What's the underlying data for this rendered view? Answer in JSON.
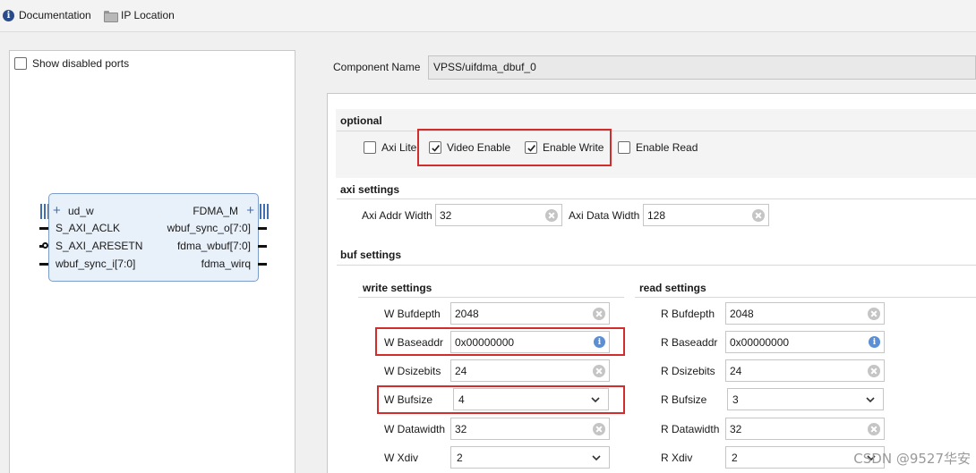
{
  "toolbar": {
    "documentation_label": "Documentation",
    "ip_location_label": "IP Location",
    "documentation_icon": "info-icon",
    "ip_location_icon": "folder-icon"
  },
  "left_panel": {
    "show_disabled_ports_label": "Show disabled ports",
    "show_disabled_ports_checked": false
  },
  "ip_block": {
    "left_ports": [
      "ud_w",
      "S_AXI_ACLK",
      "S_AXI_ARESETN",
      "wbuf_sync_i[7:0]"
    ],
    "right_ports": [
      "FDMA_M",
      "wbuf_sync_o[7:0]",
      "fdma_wbuf[7:0]",
      "fdma_wirq"
    ]
  },
  "component": {
    "label": "Component Name",
    "value": "VPSS/uifdma_dbuf_0"
  },
  "optional": {
    "title": "optional",
    "axi_lite": {
      "label": "Axi Lite",
      "checked": false
    },
    "video_enable": {
      "label": "Video Enable",
      "checked": true
    },
    "enable_write": {
      "label": "Enable Write",
      "checked": true
    },
    "enable_read": {
      "label": "Enable Read",
      "checked": false
    }
  },
  "axi_settings": {
    "title": "axi settings",
    "addr_width_label": "Axi Addr Width",
    "addr_width_value": "32",
    "data_width_label": "Axi Data Width",
    "data_width_value": "128"
  },
  "buf_settings": {
    "title": "buf settings",
    "write": {
      "title": "write settings",
      "bufdepth_label": "W Bufdepth",
      "bufdepth_value": "2048",
      "baseaddr_label": "W Baseaddr",
      "baseaddr_value": "0x00000000",
      "dsizebits_label": "W Dsizebits",
      "dsizebits_value": "24",
      "bufsize_label": "W Bufsize",
      "bufsize_value": "4",
      "datawidth_label": "W Datawidth",
      "datawidth_value": "32",
      "xdiv_label": "W Xdiv",
      "xdiv_value": "2"
    },
    "read": {
      "title": "read settings",
      "bufdepth_label": "R Bufdepth",
      "bufdepth_value": "2048",
      "baseaddr_label": "R Baseaddr",
      "baseaddr_value": "0x00000000",
      "dsizebits_label": "R Dsizebits",
      "dsizebits_value": "24",
      "bufsize_label": "R Bufsize",
      "bufsize_value": "3",
      "datawidth_label": "R Datawidth",
      "datawidth_value": "32",
      "xdiv_label": "R Xdiv",
      "xdiv_value": "2"
    }
  },
  "watermark": "CSDN @9527华安",
  "colors": {
    "highlight": "#d22d2d",
    "ip_block_fill": "#e8f0fa",
    "accent": "#3f6fb0"
  }
}
